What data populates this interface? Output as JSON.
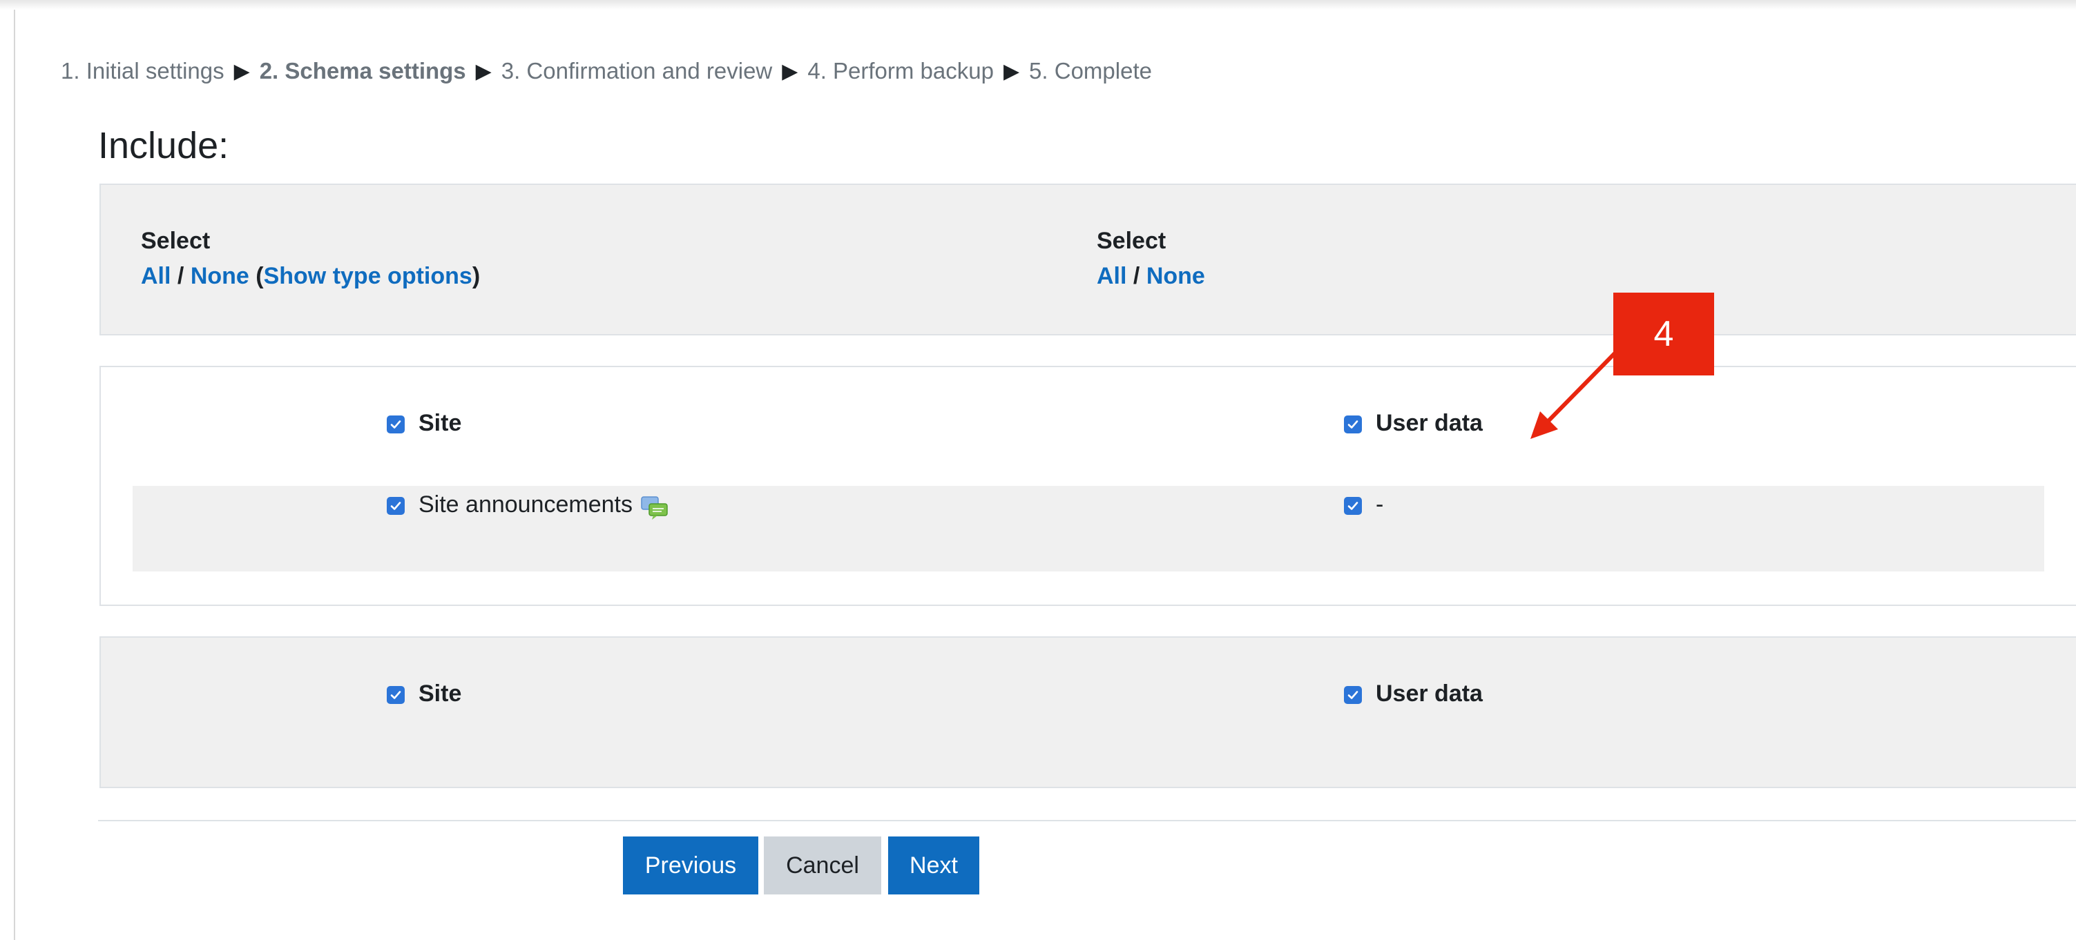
{
  "progress": {
    "steps": [
      {
        "label": "1. Initial settings",
        "current": false
      },
      {
        "label": "2. Schema settings",
        "current": true
      },
      {
        "label": "3. Confirmation and review",
        "current": false
      },
      {
        "label": "4. Perform backup",
        "current": false
      },
      {
        "label": "5. Complete",
        "current": false
      }
    ],
    "separator": "▶"
  },
  "heading": "Include:",
  "select_panel": {
    "left": {
      "label": "Select",
      "all": "All",
      "slash": "/",
      "none": "None",
      "open_paren": "(",
      "show_type_options": "Show type options",
      "close_paren": ")"
    },
    "right": {
      "label": "Select",
      "all": "All",
      "slash": "/",
      "none": "None"
    }
  },
  "items_panel": {
    "header_left": "Site",
    "header_right": "User data",
    "row_left": "Site announcements",
    "row_right": "-"
  },
  "footer_panel": {
    "left": "Site",
    "right": "User data"
  },
  "buttons": {
    "previous": "Previous",
    "cancel": "Cancel",
    "next": "Next"
  },
  "annotation": {
    "badge": "4",
    "color": "#e8260f"
  },
  "colors": {
    "link": "#0f6cbf",
    "checkbox": "#2b74d8",
    "panel_grey": "#f0f0f0"
  }
}
